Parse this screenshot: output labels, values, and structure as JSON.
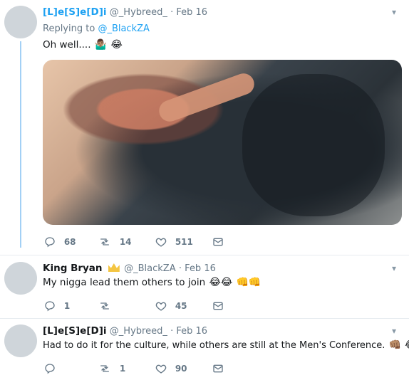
{
  "colors": {
    "link": "#1da1f2",
    "meta": "#657786",
    "thread_line": "#a3d0f5",
    "crown": "#f4c542"
  },
  "tweets": [
    {
      "author_name": "[L]e[S]e[D]i",
      "handle": "@_Hybreed_",
      "date": "· Feb 16",
      "replying_prefix": "Replying to ",
      "replying_handle": "@_BlackZA",
      "text": "Oh well....",
      "emojis": [
        "🤷🏽‍♂️",
        "😂"
      ],
      "has_media": true,
      "actions": {
        "reply_count": "68",
        "retweet_count": "14",
        "like_count": "511"
      },
      "icons": [
        "reply-icon",
        "retweet-icon",
        "heart-icon",
        "message-icon",
        "chevron-down-icon"
      ]
    },
    {
      "author_name": "King Bryan",
      "handle": "@_BlackZA",
      "date": "· Feb 16",
      "text": "My nigga lead them others to join",
      "emojis": [
        "😂😂",
        "👊👊"
      ],
      "badge_icon": "crown-icon",
      "actions": {
        "reply_count": "1",
        "retweet_count": "",
        "like_count": "45"
      }
    },
    {
      "author_name": "[L]e[S]e[D]i",
      "handle": "@_Hybreed_",
      "date": "· Feb 16",
      "text": "Had to do it for the culture, while others are still at the Men's Conference.",
      "emojis": [
        "👊🏽",
        "😂"
      ],
      "actions": {
        "reply_count": "",
        "retweet_count": "1",
        "like_count": "90"
      }
    }
  ]
}
